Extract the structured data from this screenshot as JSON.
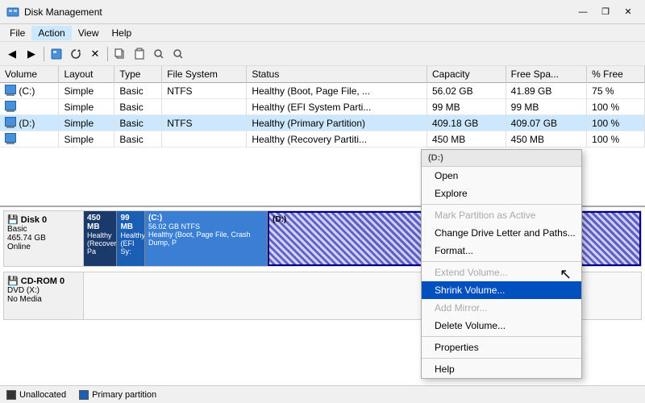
{
  "window": {
    "title": "Disk Management",
    "controls": {
      "minimize": "—",
      "restore": "❐",
      "close": "✕"
    }
  },
  "menubar": {
    "items": [
      "File",
      "Action",
      "View",
      "Help"
    ]
  },
  "toolbar": {
    "buttons": [
      "◀",
      "▶",
      "🖥",
      "🗑",
      "✕",
      "📋",
      "📄",
      "🔍",
      "🔍"
    ]
  },
  "table": {
    "columns": [
      "Volume",
      "Layout",
      "Type",
      "File System",
      "Status",
      "Capacity",
      "Free Spa...",
      "% Free"
    ],
    "rows": [
      {
        "volume": "(C:)",
        "layout": "Simple",
        "type": "Basic",
        "fs": "NTFS",
        "status": "Healthy (Boot, Page File, ...",
        "capacity": "56.02 GB",
        "free": "41.89 GB",
        "pct": "75 %",
        "hasIcon": true
      },
      {
        "volume": "",
        "layout": "Simple",
        "type": "Basic",
        "fs": "",
        "status": "Healthy (EFI System Parti...",
        "capacity": "99 MB",
        "free": "99 MB",
        "pct": "100 %",
        "hasIcon": true
      },
      {
        "volume": "(D:)",
        "layout": "Simple",
        "type": "Basic",
        "fs": "NTFS",
        "status": "Healthy (Primary Partition)",
        "capacity": "409.18 GB",
        "free": "409.07 GB",
        "pct": "100 %",
        "hasIcon": true
      },
      {
        "volume": "",
        "layout": "Simple",
        "type": "Basic",
        "fs": "",
        "status": "Healthy (Recovery Partiti...",
        "capacity": "450 MB",
        "free": "450 MB",
        "pct": "100 %",
        "hasIcon": true
      }
    ]
  },
  "disks": [
    {
      "name": "Disk 0",
      "type": "Basic",
      "size": "465.74 GB",
      "status": "Online",
      "partitions": [
        {
          "style": "blue-dark",
          "size": "450 MB",
          "label": "Healthy (Recovery Pa",
          "widthPct": 6
        },
        {
          "style": "blue-med",
          "size": "99 MB",
          "label": "Healthy (EFI Sy:",
          "widthPct": 5
        },
        {
          "style": "blue-light",
          "size": "56.02 GB NTFS",
          "label": "(C:)\nHealthy (Boot, Page File, Crash Dump, P",
          "widthPct": 22,
          "extra": "(C:)"
        },
        {
          "style": "hatched selected-partition",
          "size": "(D:)",
          "label": "",
          "widthPct": 67
        }
      ]
    },
    {
      "name": "CD-ROM 0",
      "type": "DVD (X:)",
      "size": "",
      "status": "No Media",
      "partitions": []
    }
  ],
  "context_menu": {
    "header": "(D:)",
    "items": [
      {
        "label": "Open",
        "type": "normal"
      },
      {
        "label": "Explore",
        "type": "normal"
      },
      {
        "label": "sep1",
        "type": "separator"
      },
      {
        "label": "Mark Partition as Active",
        "type": "disabled"
      },
      {
        "label": "Change Drive Letter and Paths...",
        "type": "normal"
      },
      {
        "label": "Format...",
        "type": "normal"
      },
      {
        "label": "sep2",
        "type": "separator"
      },
      {
        "label": "Extend Volume...",
        "type": "disabled"
      },
      {
        "label": "Shrink Volume...",
        "type": "highlighted"
      },
      {
        "label": "Add Mirror...",
        "type": "disabled"
      },
      {
        "label": "Delete Volume...",
        "type": "normal"
      },
      {
        "label": "sep3",
        "type": "separator"
      },
      {
        "label": "Properties",
        "type": "normal"
      },
      {
        "label": "sep4",
        "type": "separator"
      },
      {
        "label": "Help",
        "type": "normal"
      }
    ]
  },
  "legend": {
    "items": [
      {
        "type": "unalloc",
        "label": "Unallocated"
      },
      {
        "type": "primary",
        "label": "Primary partition"
      }
    ]
  }
}
